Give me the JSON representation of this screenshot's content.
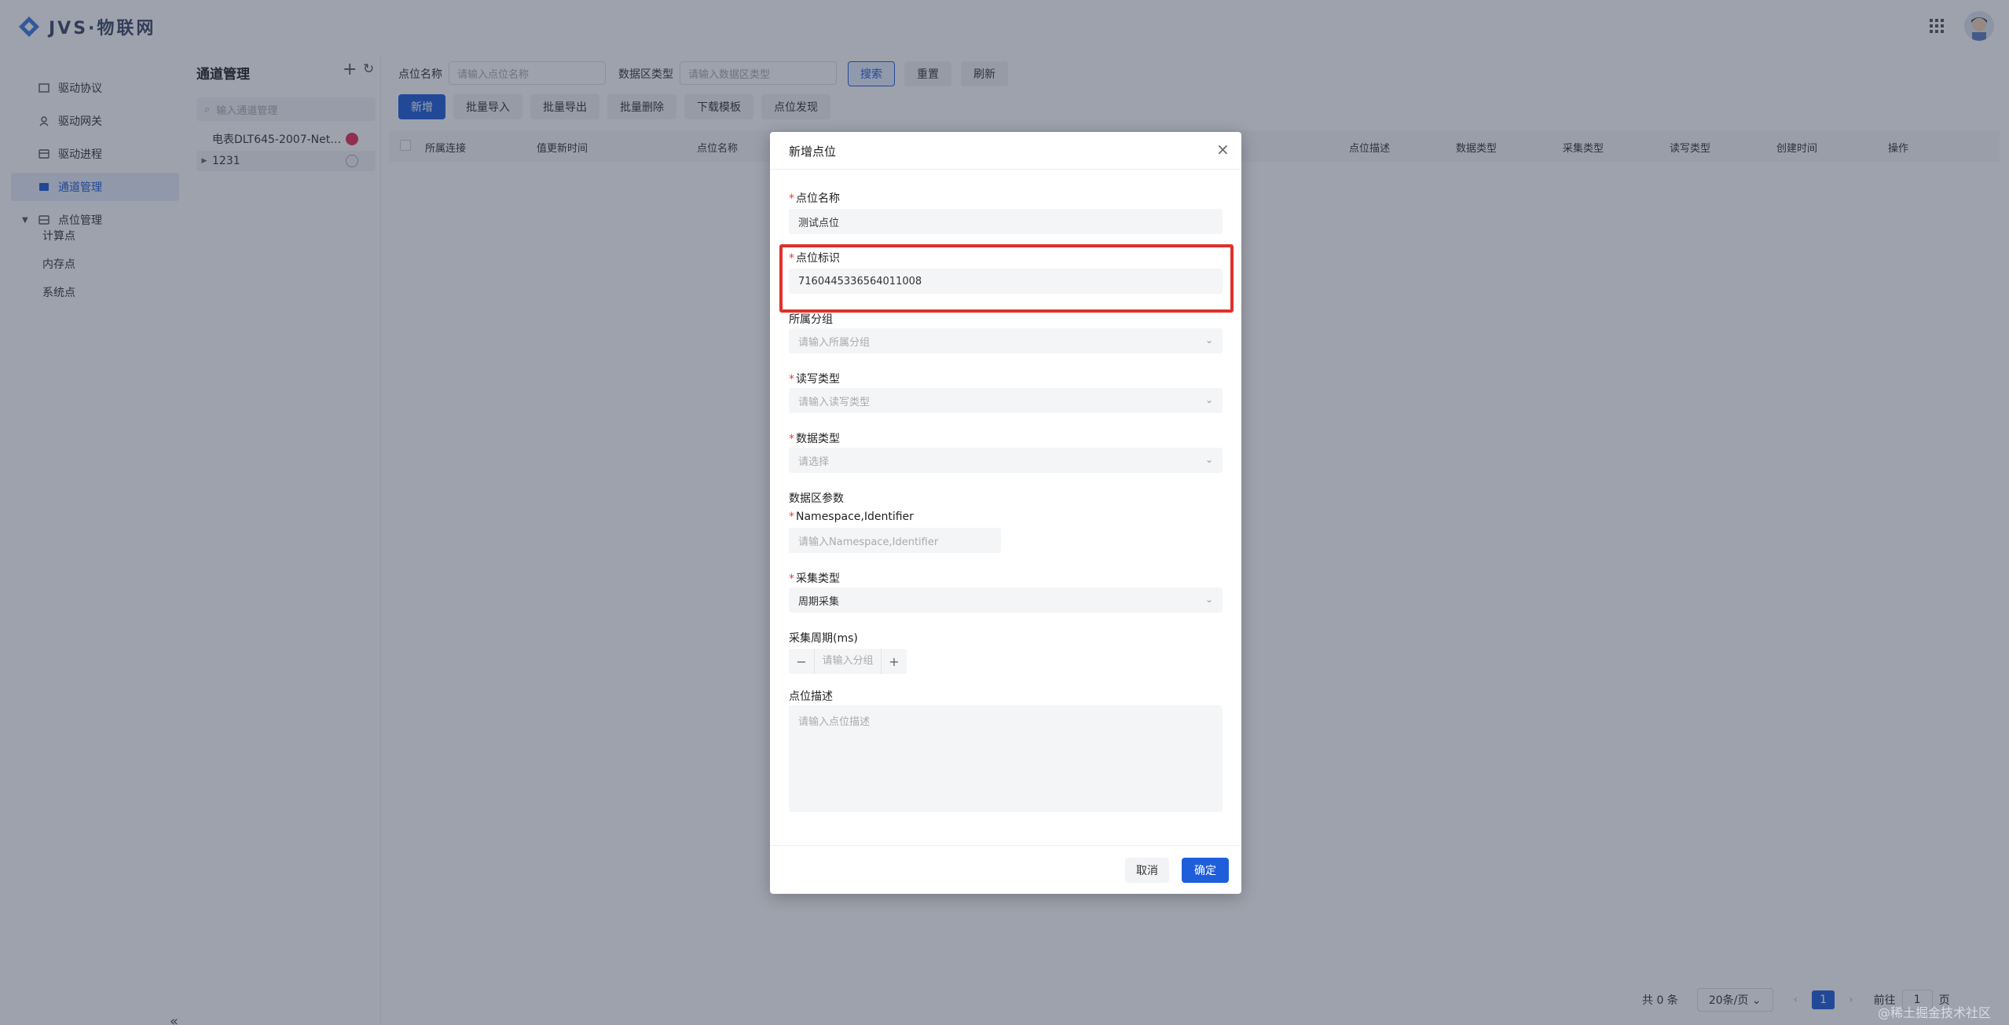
{
  "app": {
    "title": "JVS·物联网"
  },
  "sidebar": {
    "items": [
      {
        "label": "驱动协议",
        "icon": "protocol-icon"
      },
      {
        "label": "驱动网关",
        "icon": "gateway-icon"
      },
      {
        "label": "驱动进程",
        "icon": "process-icon"
      },
      {
        "label": "通道管理",
        "icon": "channel-icon",
        "active": true
      },
      {
        "label": "点位管理",
        "icon": "point-icon",
        "expanded": true
      }
    ],
    "sub_items": [
      "计算点",
      "内存点",
      "系统点"
    ]
  },
  "tree": {
    "title": "通道管理",
    "search_placeholder": "输入通道管理",
    "nodes": [
      {
        "label": "电表DLT645-2007-Net…"
      },
      {
        "label": "1231"
      }
    ]
  },
  "filters": {
    "point_name_label": "点位名称",
    "point_name_placeholder": "请输入点位名称",
    "data_area_label": "数据区类型",
    "data_area_placeholder": "请输入数据区类型",
    "search": "搜索",
    "reset": "重置",
    "refresh": "刷新"
  },
  "toolbar": {
    "add": "新增",
    "batch_import": "批量导入",
    "batch_export": "批量导出",
    "batch_delete": "批量删除",
    "download_template": "下载模板",
    "point_discovery": "点位发现"
  },
  "table": {
    "columns": [
      "所属连接",
      "值更新时间",
      "点位名称",
      "点位描述",
      "数据类型",
      "采集类型",
      "读写类型",
      "创建时间",
      "操作"
    ]
  },
  "pagination": {
    "total": "共 0 条",
    "page_size": "20条/页",
    "current_page": "1",
    "goto_label": "前往",
    "goto_value": "1",
    "page_suffix": "页"
  },
  "modal": {
    "title": "新增点位",
    "fields": {
      "point_name": {
        "label": "点位名称",
        "value": "测试点位"
      },
      "point_id": {
        "label": "点位标识",
        "value": "7160445336564011008"
      },
      "group": {
        "label": "所属分组",
        "placeholder": "请输入所属分组"
      },
      "rw_type": {
        "label": "读写类型",
        "placeholder": "请输入读写类型"
      },
      "data_type": {
        "label": "数据类型",
        "placeholder": "请选择"
      },
      "data_area_params": {
        "label": "数据区参数"
      },
      "namespace": {
        "label": "Namespace,Identifier",
        "placeholder": "请输入Namespace,Identifier"
      },
      "collect_type": {
        "label": "采集类型",
        "value": "周期采集"
      },
      "collect_period": {
        "label": "采集周期(ms)",
        "placeholder": "请输入分组"
      },
      "description": {
        "label": "点位描述",
        "placeholder": "请输入点位描述"
      }
    },
    "cancel": "取消",
    "confirm": "确定"
  },
  "watermark": "@稀土掘金技术社区",
  "colors": {
    "primary": "#1e5edb",
    "highlight": "#e0302a"
  }
}
